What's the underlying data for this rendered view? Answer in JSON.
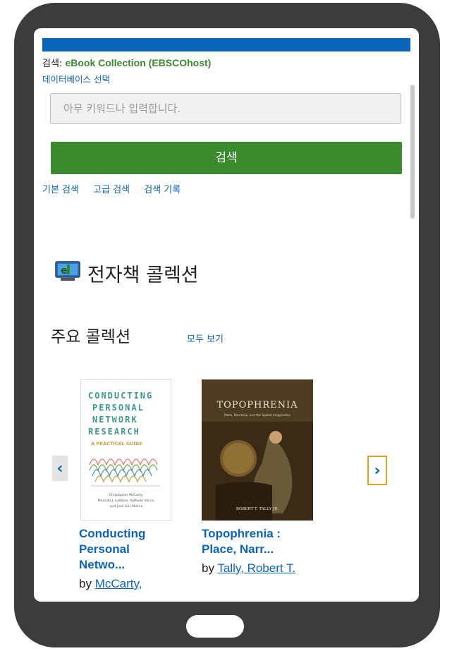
{
  "search": {
    "prefix": "검색: ",
    "collection": "eBook Collection (EBSCOhost)",
    "db_select": "데이터베이스 선택",
    "placeholder": "아무 키워드나 입력합니다.",
    "button": "검색",
    "links": [
      "기본 검색",
      "고급 검색",
      "검색 기록"
    ]
  },
  "ebook": {
    "title": "전자책 콜렉션",
    "featured_label": "주요 콜렉션",
    "view_all": "모두 보기"
  },
  "carousel": {
    "prev_icon": "chevron-left-icon",
    "next_icon": "chevron-right-icon",
    "prev_symbol": "‹",
    "next_symbol": "›",
    "books": [
      {
        "title_lines": [
          "Conducting",
          "Personal",
          "Netwo..."
        ],
        "by": "by ",
        "author": "McCarty,",
        "cover_title_lines": [
          "CONDUCTING",
          "PERSONAL",
          "NETWORK",
          "RESEARCH"
        ],
        "cover_subtitle": "A PRACTICAL GUIDE",
        "cover_authors_lines": [
          "Christopher McCarty,",
          "Miranda J. Lubbers, Raffaele Vacca,",
          "and José Luis Molina"
        ]
      },
      {
        "title_lines": [
          "Topophrenia :",
          "Place, Narr..."
        ],
        "by": "by ",
        "author": "Tally, Robert T.",
        "cover_title": "TOPOPHRENIA",
        "cover_subtitle": "Place, Narrative, and the Spatial Imagination",
        "cover_author": "ROBERT T. TALLY JR."
      }
    ]
  },
  "colors": {
    "accent_blue": "#0c64b8",
    "search_green": "#3b8a2e",
    "device_frame": "#3c3c3c",
    "next_arrow_border": "#e8a020"
  }
}
